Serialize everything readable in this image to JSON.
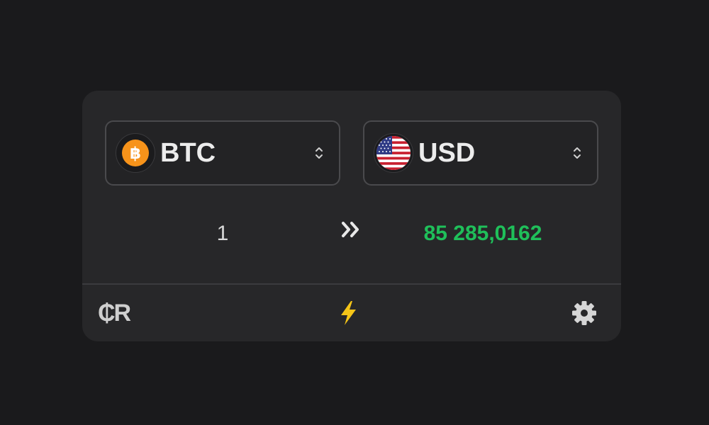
{
  "converter": {
    "from": {
      "code": "BTC",
      "icon": "bitcoin-icon",
      "color": "#f7931a"
    },
    "to": {
      "code": "USD",
      "icon": "us-flag-icon"
    },
    "amount_in": "1",
    "amount_out": "85 285,0162",
    "result_color": "#1fc05a"
  },
  "footer": {
    "logo_text": "₵R",
    "actions": [
      "lightning-icon",
      "gear-icon"
    ],
    "accent": "#f5c518"
  }
}
